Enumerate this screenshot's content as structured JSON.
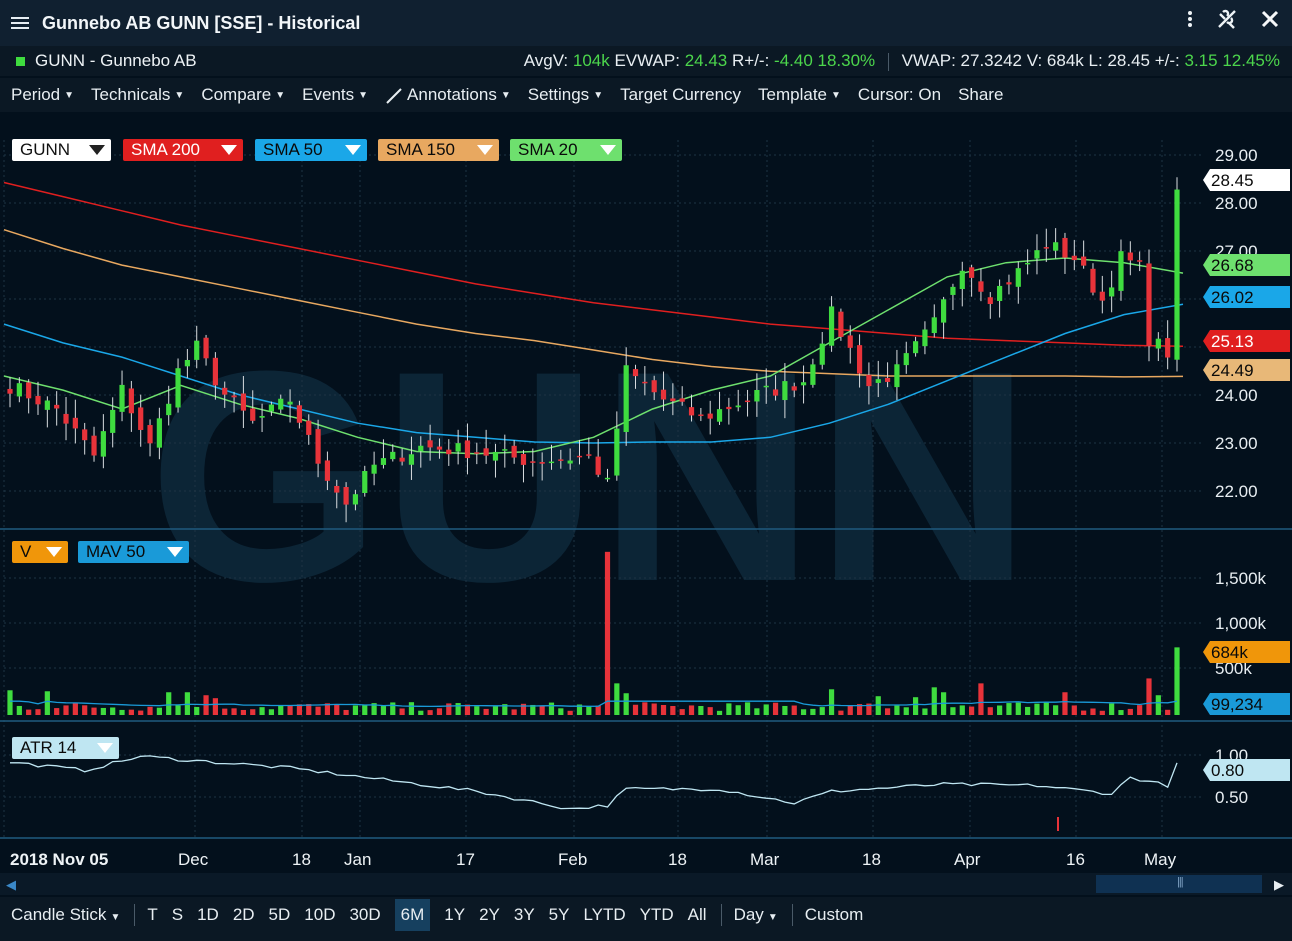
{
  "window": {
    "title": "Gunnebo AB GUNN [SSE] - Historical",
    "icons": [
      "menu-icon",
      "more-vertical-icon",
      "unlink-icon",
      "close-icon"
    ]
  },
  "infobar": {
    "instrument": "GUNN - Gunnebo AB",
    "avgv_label": "AvgV:",
    "avgv_value": "104k",
    "evwap_label": "EVWAP:",
    "evwap_value": "24.43",
    "rpm_label": "R+/-:",
    "rpm_value": "-4.40",
    "rpm_pct": "18.30%",
    "vwap_label": "VWAP:",
    "vwap_value": "27.3242",
    "v_label": "V:",
    "v_value": "684k",
    "l_label": "L:",
    "l_value": "28.45",
    "pm_label": "+/-:",
    "pm_value": "3.15",
    "pm_pct": "12.45%"
  },
  "toolbar": {
    "items": [
      {
        "label": "Period",
        "caret": true
      },
      {
        "label": "Technicals",
        "caret": true
      },
      {
        "label": "Compare",
        "caret": true
      },
      {
        "label": "Events",
        "caret": true
      },
      {
        "label": "Annotations",
        "caret": true,
        "icon": "pencil-line-icon"
      },
      {
        "label": "Settings",
        "caret": true
      },
      {
        "label": "Target Currency",
        "caret": false
      },
      {
        "label": "Template",
        "caret": true
      },
      {
        "label": "Cursor: On",
        "caret": false
      },
      {
        "label": "Share",
        "caret": false
      }
    ]
  },
  "watermark": "GUNN",
  "colors": {
    "up": "#3fdc3f",
    "down": "#e8333a",
    "sma200": "#e01f1f",
    "sma50": "#1aa7e8",
    "sma150": "#e8a860",
    "sma20": "#6ee06e",
    "price_tag": "#ffffff",
    "volume_tag": "#f0960a",
    "mav_tag": "#1a9ad8",
    "atr": "#bfe6f2"
  },
  "legends": {
    "price": [
      "GUNN",
      "SMA 200",
      "SMA 50",
      "SMA 150",
      "SMA 20"
    ],
    "volume": [
      "V",
      "MAV 50"
    ],
    "atr": [
      "ATR 14"
    ]
  },
  "chart_data": [
    {
      "type": "candlestick",
      "panel": "price",
      "title": "",
      "ylim": [
        21.3,
        29.5
      ],
      "yticks": [
        "29.00",
        "28.00",
        "27.00",
        "24.00",
        "23.00",
        "22.00"
      ],
      "last_values": {
        "GUNN": "28.45",
        "SMA 20": "26.68",
        "SMA 50": "26.02",
        "SMA 200": "25.13",
        "SMA 150": "24.49"
      },
      "x_labels": [
        "2018 Nov 05",
        "Dec",
        "18",
        "Jan",
        "17",
        "Feb",
        "18",
        "Mar",
        "18",
        "Apr",
        "16",
        "May"
      ],
      "series": [
        {
          "name": "SMA 200",
          "values": [
            28.6,
            28.3,
            28.0,
            27.7,
            27.45,
            27.2,
            26.95,
            26.7,
            26.45,
            26.25,
            26.05,
            25.9,
            25.75,
            25.6,
            25.5,
            25.4,
            25.3,
            25.25,
            25.2,
            25.15,
            25.13
          ]
        },
        {
          "name": "SMA 150",
          "values": [
            27.6,
            27.2,
            26.85,
            26.6,
            26.35,
            26.1,
            25.85,
            25.6,
            25.4,
            25.25,
            25.05,
            24.85,
            24.7,
            24.6,
            24.55,
            24.5,
            24.5,
            24.5,
            24.5,
            24.48,
            24.49
          ]
        },
        {
          "name": "SMA 50",
          "values": [
            25.6,
            25.2,
            24.9,
            24.5,
            24.1,
            23.8,
            23.5,
            23.3,
            23.2,
            23.1,
            23.08,
            23.1,
            23.1,
            23.2,
            23.5,
            23.9,
            24.4,
            24.9,
            25.4,
            25.8,
            26.02
          ]
        },
        {
          "name": "SMA 20",
          "values": [
            24.5,
            24.2,
            23.8,
            24.3,
            23.9,
            23.6,
            23.2,
            22.9,
            22.85,
            22.9,
            23.2,
            23.8,
            24.2,
            24.5,
            25.2,
            25.9,
            26.6,
            26.9,
            27.0,
            26.9,
            26.68
          ]
        }
      ]
    },
    {
      "type": "bar",
      "panel": "volume",
      "ylim": [
        0,
        1800
      ],
      "yticks": [
        "1,500k",
        "1,000k",
        "500k"
      ],
      "last_values": {
        "V": "684k",
        "MAV 50": "99,234"
      }
    },
    {
      "type": "line",
      "panel": "atr",
      "ylim": [
        0.2,
        1.1
      ],
      "yticks": [
        "1.00",
        "0.50"
      ],
      "last_values": {
        "ATR 14": "0.80"
      }
    }
  ],
  "scrollbar": {
    "icons": [
      "scroll-left-icon",
      "scroll-right-icon"
    ]
  },
  "bottombar": {
    "chart_type": "Candle Stick",
    "ranges": [
      "T",
      "S",
      "1D",
      "2D",
      "5D",
      "10D",
      "30D",
      "6M",
      "1Y",
      "2Y",
      "3Y",
      "5Y",
      "LYTD",
      "YTD",
      "All"
    ],
    "active_range": "6M",
    "interval": "Day",
    "custom": "Custom"
  }
}
